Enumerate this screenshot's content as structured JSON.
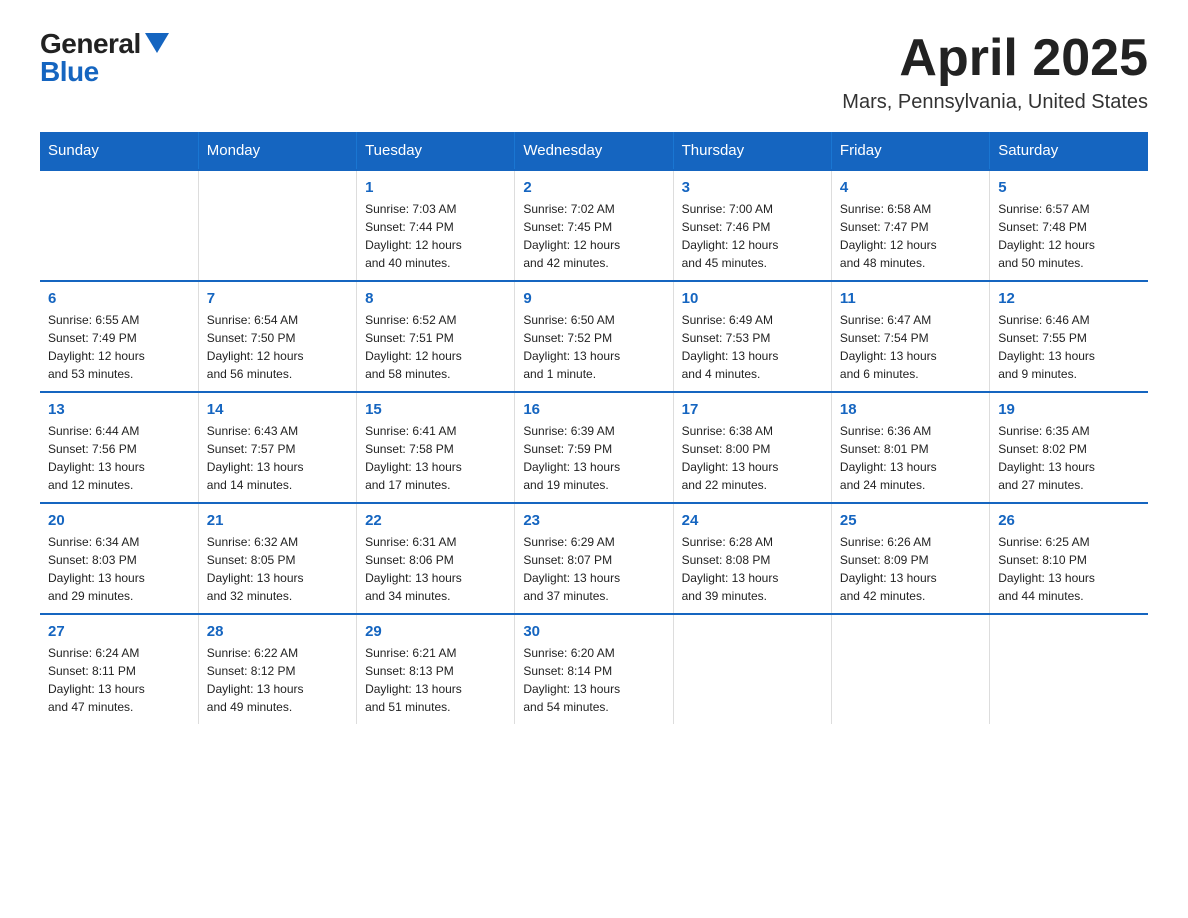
{
  "logo": {
    "general": "General",
    "blue": "Blue"
  },
  "title": {
    "month_year": "April 2025",
    "location": "Mars, Pennsylvania, United States"
  },
  "days_of_week": [
    "Sunday",
    "Monday",
    "Tuesday",
    "Wednesday",
    "Thursday",
    "Friday",
    "Saturday"
  ],
  "weeks": [
    [
      {
        "num": "",
        "info": ""
      },
      {
        "num": "",
        "info": ""
      },
      {
        "num": "1",
        "info": "Sunrise: 7:03 AM\nSunset: 7:44 PM\nDaylight: 12 hours\nand 40 minutes."
      },
      {
        "num": "2",
        "info": "Sunrise: 7:02 AM\nSunset: 7:45 PM\nDaylight: 12 hours\nand 42 minutes."
      },
      {
        "num": "3",
        "info": "Sunrise: 7:00 AM\nSunset: 7:46 PM\nDaylight: 12 hours\nand 45 minutes."
      },
      {
        "num": "4",
        "info": "Sunrise: 6:58 AM\nSunset: 7:47 PM\nDaylight: 12 hours\nand 48 minutes."
      },
      {
        "num": "5",
        "info": "Sunrise: 6:57 AM\nSunset: 7:48 PM\nDaylight: 12 hours\nand 50 minutes."
      }
    ],
    [
      {
        "num": "6",
        "info": "Sunrise: 6:55 AM\nSunset: 7:49 PM\nDaylight: 12 hours\nand 53 minutes."
      },
      {
        "num": "7",
        "info": "Sunrise: 6:54 AM\nSunset: 7:50 PM\nDaylight: 12 hours\nand 56 minutes."
      },
      {
        "num": "8",
        "info": "Sunrise: 6:52 AM\nSunset: 7:51 PM\nDaylight: 12 hours\nand 58 minutes."
      },
      {
        "num": "9",
        "info": "Sunrise: 6:50 AM\nSunset: 7:52 PM\nDaylight: 13 hours\nand 1 minute."
      },
      {
        "num": "10",
        "info": "Sunrise: 6:49 AM\nSunset: 7:53 PM\nDaylight: 13 hours\nand 4 minutes."
      },
      {
        "num": "11",
        "info": "Sunrise: 6:47 AM\nSunset: 7:54 PM\nDaylight: 13 hours\nand 6 minutes."
      },
      {
        "num": "12",
        "info": "Sunrise: 6:46 AM\nSunset: 7:55 PM\nDaylight: 13 hours\nand 9 minutes."
      }
    ],
    [
      {
        "num": "13",
        "info": "Sunrise: 6:44 AM\nSunset: 7:56 PM\nDaylight: 13 hours\nand 12 minutes."
      },
      {
        "num": "14",
        "info": "Sunrise: 6:43 AM\nSunset: 7:57 PM\nDaylight: 13 hours\nand 14 minutes."
      },
      {
        "num": "15",
        "info": "Sunrise: 6:41 AM\nSunset: 7:58 PM\nDaylight: 13 hours\nand 17 minutes."
      },
      {
        "num": "16",
        "info": "Sunrise: 6:39 AM\nSunset: 7:59 PM\nDaylight: 13 hours\nand 19 minutes."
      },
      {
        "num": "17",
        "info": "Sunrise: 6:38 AM\nSunset: 8:00 PM\nDaylight: 13 hours\nand 22 minutes."
      },
      {
        "num": "18",
        "info": "Sunrise: 6:36 AM\nSunset: 8:01 PM\nDaylight: 13 hours\nand 24 minutes."
      },
      {
        "num": "19",
        "info": "Sunrise: 6:35 AM\nSunset: 8:02 PM\nDaylight: 13 hours\nand 27 minutes."
      }
    ],
    [
      {
        "num": "20",
        "info": "Sunrise: 6:34 AM\nSunset: 8:03 PM\nDaylight: 13 hours\nand 29 minutes."
      },
      {
        "num": "21",
        "info": "Sunrise: 6:32 AM\nSunset: 8:05 PM\nDaylight: 13 hours\nand 32 minutes."
      },
      {
        "num": "22",
        "info": "Sunrise: 6:31 AM\nSunset: 8:06 PM\nDaylight: 13 hours\nand 34 minutes."
      },
      {
        "num": "23",
        "info": "Sunrise: 6:29 AM\nSunset: 8:07 PM\nDaylight: 13 hours\nand 37 minutes."
      },
      {
        "num": "24",
        "info": "Sunrise: 6:28 AM\nSunset: 8:08 PM\nDaylight: 13 hours\nand 39 minutes."
      },
      {
        "num": "25",
        "info": "Sunrise: 6:26 AM\nSunset: 8:09 PM\nDaylight: 13 hours\nand 42 minutes."
      },
      {
        "num": "26",
        "info": "Sunrise: 6:25 AM\nSunset: 8:10 PM\nDaylight: 13 hours\nand 44 minutes."
      }
    ],
    [
      {
        "num": "27",
        "info": "Sunrise: 6:24 AM\nSunset: 8:11 PM\nDaylight: 13 hours\nand 47 minutes."
      },
      {
        "num": "28",
        "info": "Sunrise: 6:22 AM\nSunset: 8:12 PM\nDaylight: 13 hours\nand 49 minutes."
      },
      {
        "num": "29",
        "info": "Sunrise: 6:21 AM\nSunset: 8:13 PM\nDaylight: 13 hours\nand 51 minutes."
      },
      {
        "num": "30",
        "info": "Sunrise: 6:20 AM\nSunset: 8:14 PM\nDaylight: 13 hours\nand 54 minutes."
      },
      {
        "num": "",
        "info": ""
      },
      {
        "num": "",
        "info": ""
      },
      {
        "num": "",
        "info": ""
      }
    ]
  ]
}
